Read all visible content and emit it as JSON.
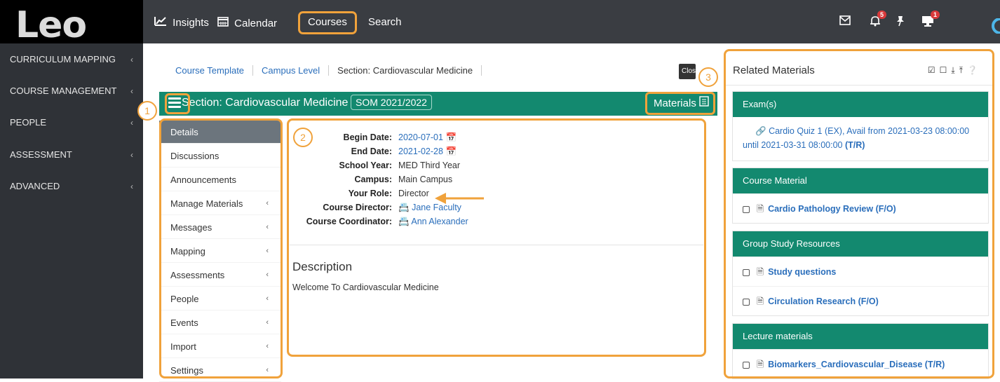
{
  "app": {
    "logo": "Leo"
  },
  "sidebar": {
    "items": [
      {
        "label": "CURRICULUM MAPPING"
      },
      {
        "label": "COURSE MANAGEMENT"
      },
      {
        "label": "PEOPLE"
      },
      {
        "label": "ASSESSMENT"
      },
      {
        "label": "ADVANCED"
      }
    ]
  },
  "topnav": {
    "items": [
      {
        "label": "Insights"
      },
      {
        "label": "Calendar"
      },
      {
        "label": "Courses"
      },
      {
        "label": "Search"
      }
    ],
    "notifications_count": "5",
    "messages_count": "1"
  },
  "breadcrumb": {
    "items": [
      {
        "label": "Course Template"
      },
      {
        "label": "Campus Level"
      },
      {
        "label": "Section: Cardiovascular Medicine"
      }
    ],
    "close_label": "Close"
  },
  "section": {
    "title": "Section: Cardiovascular Medicine",
    "term": "SOM 2021/2022",
    "materials_label": "Materials"
  },
  "steps": [
    "1",
    "2",
    "3"
  ],
  "submenu": {
    "items": [
      {
        "label": "Details"
      },
      {
        "label": "Discussions"
      },
      {
        "label": "Announcements"
      },
      {
        "label": "Manage Materials"
      },
      {
        "label": "Messages"
      },
      {
        "label": "Mapping"
      },
      {
        "label": "Assessments"
      },
      {
        "label": "People"
      },
      {
        "label": "Events"
      },
      {
        "label": "Import"
      },
      {
        "label": "Settings"
      }
    ]
  },
  "details": {
    "begin_date_label": "Begin Date:",
    "begin_date": "2020-07-01",
    "end_date_label": "End Date:",
    "end_date": "2021-02-28",
    "school_year_label": "School Year:",
    "school_year": "MED Third Year",
    "campus_label": "Campus:",
    "campus": "Main Campus",
    "role_label": "Your Role:",
    "role": "Director",
    "director_label": "Course Director:",
    "director": "Jane Faculty",
    "coordinator_label": "Course Coordinator:",
    "coordinator": "Ann Alexander",
    "description_title": "Description",
    "description_text": "Welcome To Cardiovascular Medicine"
  },
  "related": {
    "title": "Related Materials",
    "exams": {
      "header": "Exam(s)",
      "item_text": "Cardio Quiz 1 (EX), Avail from 2021-03-23 08:00:00 until 2021-03-31 08:00:00",
      "item_tag": "(T/R)"
    },
    "course_material": {
      "header": "Course Material",
      "items": [
        {
          "label": "Cardio Pathology Review (F/O)"
        }
      ]
    },
    "group_study": {
      "header": "Group Study Resources",
      "items": [
        {
          "label": "Study questions"
        },
        {
          "label": "Circulation Research (F/O)"
        }
      ]
    },
    "lecture": {
      "header": "Lecture materials",
      "items": [
        {
          "label": "Biomarkers_Cardiovascular_Disease (T/R)"
        }
      ]
    }
  },
  "colors": {
    "accent_teal": "#13896f",
    "highlight_orange": "#f0a23b",
    "sidebar_bg": "#2f3237",
    "topbar_bg": "#3a3d42",
    "link": "#2a6ebb"
  }
}
